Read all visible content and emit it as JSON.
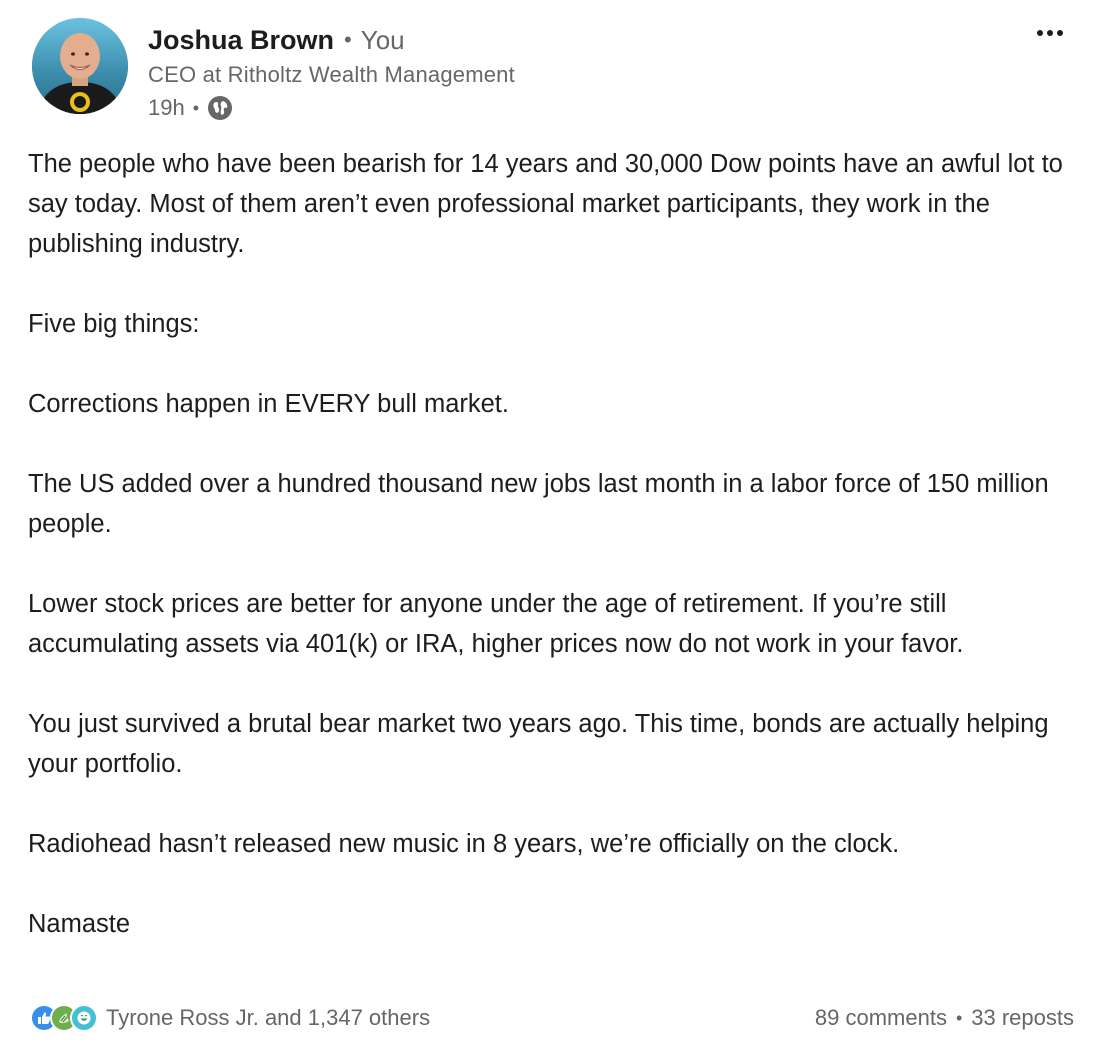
{
  "header": {
    "author_name": "Joshua Brown",
    "separator": "•",
    "relation": "You",
    "headline": "CEO at Ritholtz Wealth Management",
    "time": "19h",
    "meta_separator": "•",
    "visibility_icon": "globe-icon",
    "more_icon": "more-icon"
  },
  "body": {
    "paragraphs": [
      "The people who have been bearish for 14 years and 30,000 Dow points have an awful lot to say today. Most of them aren’t even professional market participants, they work in the publishing industry.",
      "Five big things:",
      "Corrections happen in EVERY bull market.",
      "The US added over a hundred thousand new jobs last month in a labor force of 150 million people.",
      "Lower stock prices are better for anyone under the age of retirement. If you’re still accumulating assets via 401(k) or IRA, higher prices now do not work in your favor.",
      "You just survived a brutal bear market two years ago. This time, bonds are actually helping your portfolio.",
      "Radiohead hasn’t released new music in 8 years, we’re officially on the clock.",
      "Namaste"
    ]
  },
  "footer": {
    "reaction_icons": [
      "like-icon",
      "support-icon",
      "funny-icon"
    ],
    "reactions_text": "Tyrone Ross Jr. and 1,347 others",
    "comments": "89 comments",
    "separator": "•",
    "reposts": "33 reposts"
  },
  "colors": {
    "text_primary": "#1d1d1d",
    "text_secondary": "#666666",
    "like_blue": "#378fe9",
    "support_green": "#6dae4f",
    "funny_teal": "#44bfd3"
  }
}
